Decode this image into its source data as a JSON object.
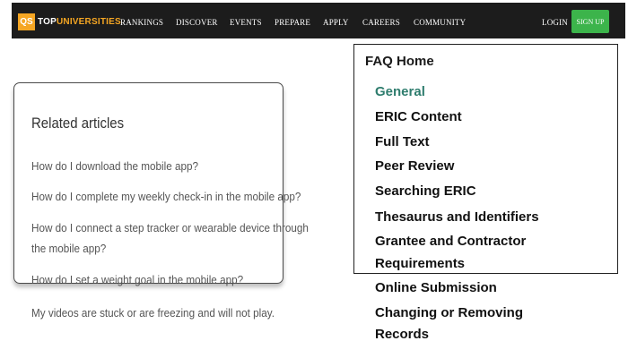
{
  "navbar": {
    "logo_mark": "QS",
    "logo_top": "TOP",
    "logo_universities": "UNIVERSITIES",
    "items": [
      "RANKINGS",
      "DISCOVER",
      "EVENTS",
      "PREPARE",
      "APPLY",
      "CAREERS",
      "COMMUNITY"
    ],
    "login": "LOGIN",
    "signup": "SIGN UP",
    "colors": {
      "bar": "#1c1c1c",
      "brand": "#f5a623",
      "signup": "#3cb44b"
    }
  },
  "related": {
    "title": "Related articles",
    "articles": [
      "How do I download the mobile app?",
      "How do I complete my weekly check-in in the mobile app?",
      "How do I connect a step tracker or wearable device through",
      "the mobile app?",
      "How do I set a weight goal in the mobile app?",
      "My videos are stuck or are freezing and will not play."
    ]
  },
  "faq": {
    "home": "FAQ Home",
    "links": [
      "General",
      "ERIC Content",
      "Full Text",
      "Peer Review",
      "Searching ERIC",
      "Thesaurus and Identifiers",
      "Grantee and Contractor",
      "Requirements",
      "Online Submission",
      "Changing or Removing",
      "Records"
    ],
    "active_color": "#2f7d6e"
  }
}
